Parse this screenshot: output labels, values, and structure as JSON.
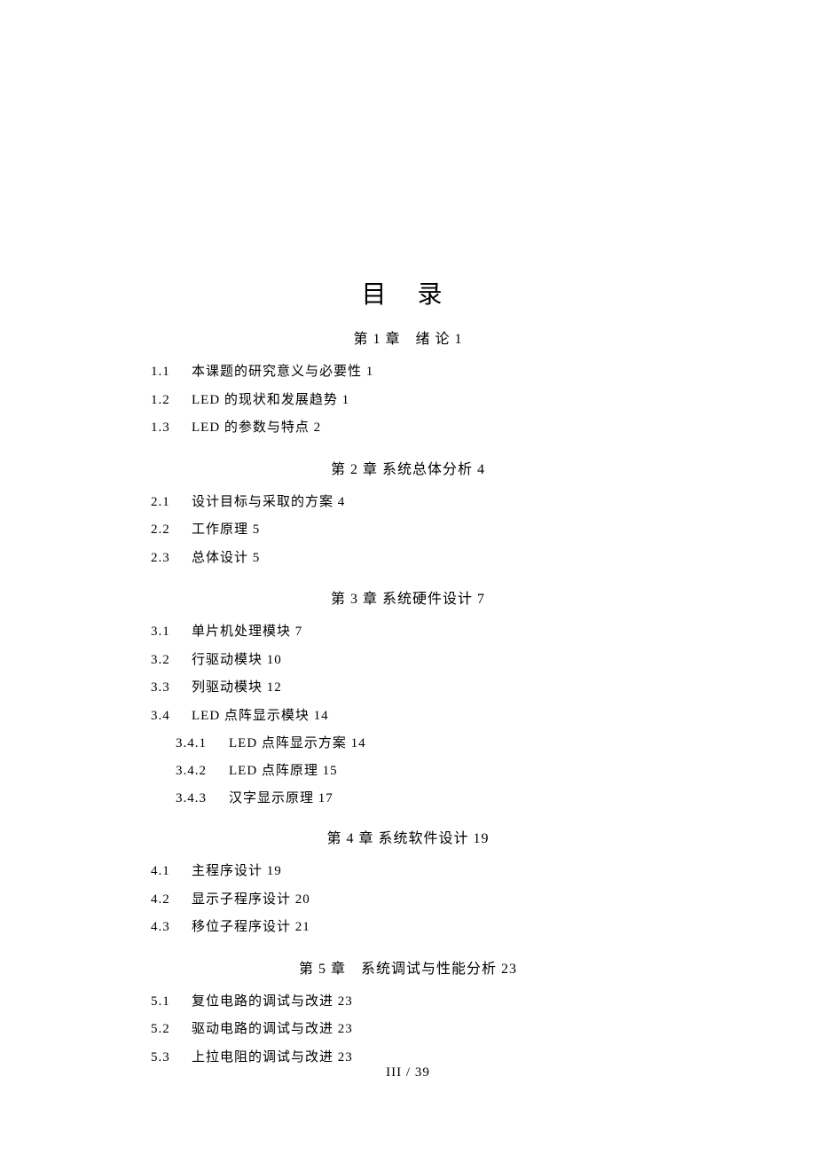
{
  "title": "目 录",
  "chapters": [
    {
      "heading": "第 1 章　绪 论 1",
      "entries": [
        {
          "num": "1.1",
          "text": "本课题的研究意义与必要性 1"
        },
        {
          "num": "1.2",
          "text": "LED 的现状和发展趋势 1"
        },
        {
          "num": "1.3",
          "text": "LED 的参数与特点 2"
        }
      ]
    },
    {
      "heading": "第 2 章 系统总体分析 4",
      "entries": [
        {
          "num": "2.1",
          "text": "设计目标与采取的方案 4"
        },
        {
          "num": "2.2",
          "text": "工作原理 5"
        },
        {
          "num": "2.3",
          "text": "总体设计 5"
        }
      ]
    },
    {
      "heading": "第 3 章 系统硬件设计 7",
      "entries": [
        {
          "num": "3.1",
          "text": "单片机处理模块 7"
        },
        {
          "num": "3.2",
          "text": "行驱动模块 10"
        },
        {
          "num": "3.3",
          "text": "列驱动模块 12"
        },
        {
          "num": "3.4",
          "text": "LED 点阵显示模块 14",
          "subs": [
            {
              "num": "3.4.1",
              "text": "LED 点阵显示方案 14"
            },
            {
              "num": "3.4.2",
              "text": "LED 点阵原理 15"
            },
            {
              "num": "3.4.3",
              "text": "汉字显示原理 17"
            }
          ]
        }
      ]
    },
    {
      "heading": "第 4 章 系统软件设计 19",
      "entries": [
        {
          "num": "4.1",
          "text": "主程序设计 19"
        },
        {
          "num": "4.2",
          "text": "显示子程序设计 20"
        },
        {
          "num": "4.3",
          "text": "移位子程序设计 21"
        }
      ]
    },
    {
      "heading": "第 5 章　系统调试与性能分析 23",
      "entries": [
        {
          "num": "5.1",
          "text": "复位电路的调试与改进 23"
        },
        {
          "num": "5.2",
          "text": "驱动电路的调试与改进 23"
        },
        {
          "num": "5.3",
          "text": "上拉电阻的调试与改进 23"
        }
      ]
    }
  ],
  "footer": "III / 39"
}
